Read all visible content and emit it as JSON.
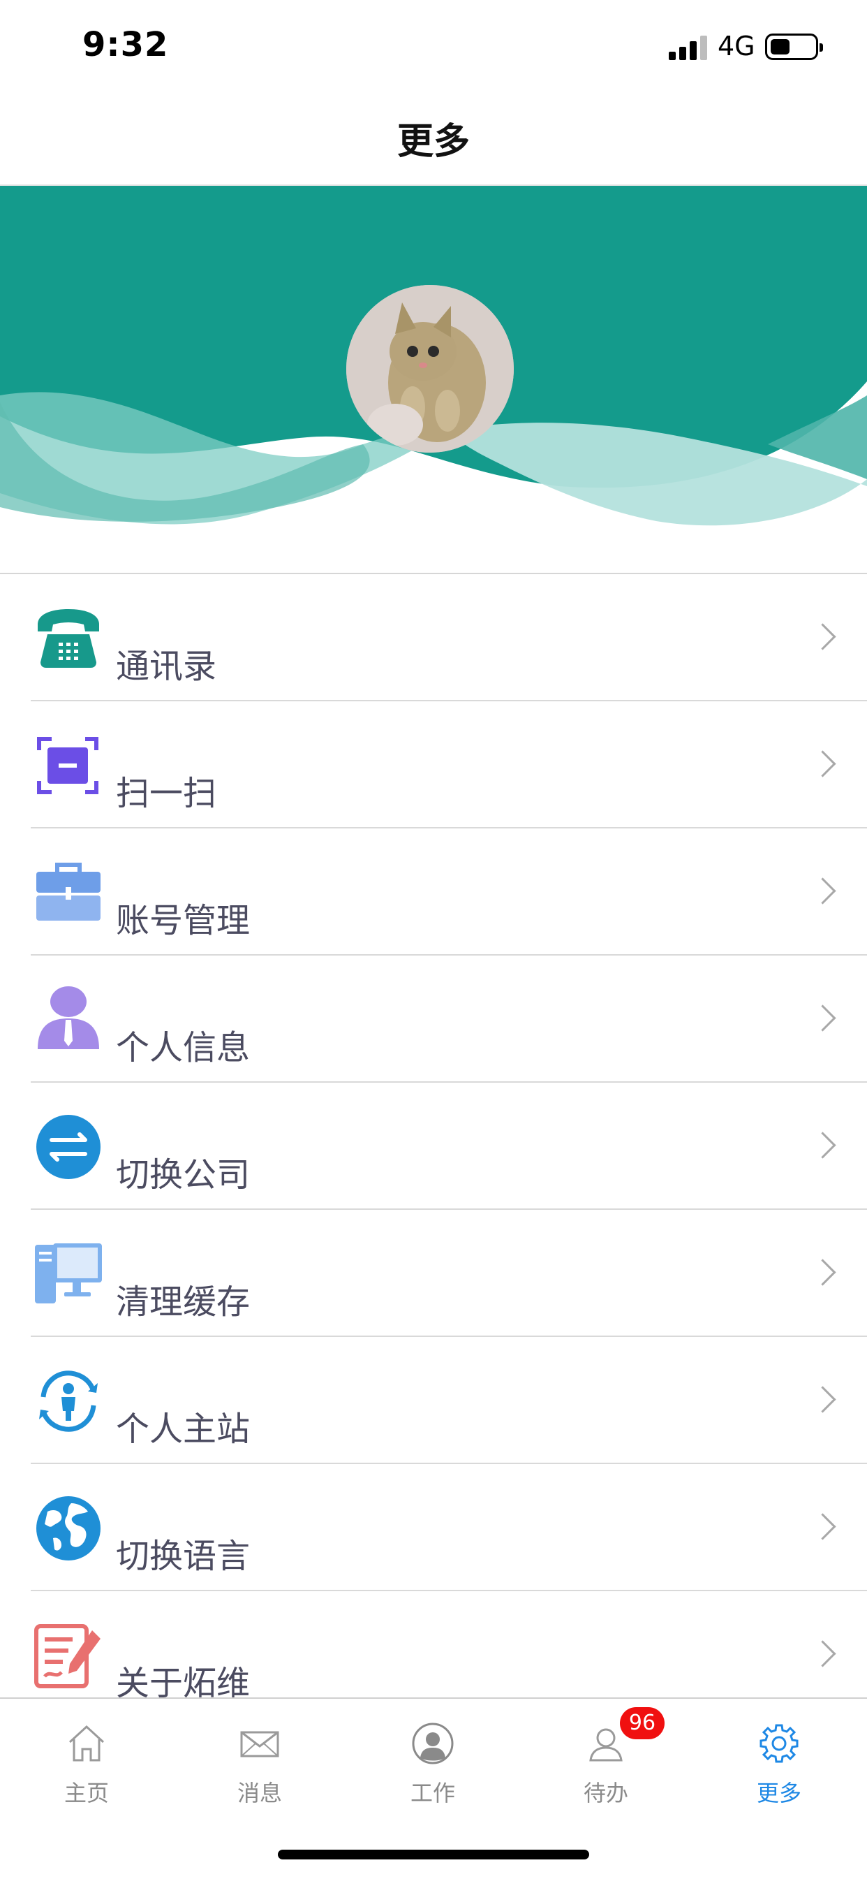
{
  "status": {
    "time": "9:32",
    "network": "4G",
    "battery_level": 0.45
  },
  "nav": {
    "title": "更多"
  },
  "header": {
    "colors": {
      "primary": "#149b8c",
      "wave_light": "#7fcdc4",
      "wave_pale": "#b4e2dd"
    }
  },
  "menu": {
    "items": [
      {
        "label": "通讯录",
        "icon": "phone-icon"
      },
      {
        "label": "扫一扫",
        "icon": "scan-icon"
      },
      {
        "label": "账号管理",
        "icon": "briefcase-icon"
      },
      {
        "label": "个人信息",
        "icon": "person-tie-icon"
      },
      {
        "label": "切换公司",
        "icon": "switch-arrows-icon"
      },
      {
        "label": "清理缓存",
        "icon": "computer-icon"
      },
      {
        "label": "个人主站",
        "icon": "person-refresh-icon"
      },
      {
        "label": "切换语言",
        "icon": "globe-icon"
      },
      {
        "label": "关于炻维",
        "icon": "document-edit-icon"
      }
    ]
  },
  "tabbar": {
    "tabs": [
      {
        "label": "主页",
        "icon": "home-icon",
        "active": false
      },
      {
        "label": "消息",
        "icon": "mail-icon",
        "active": false
      },
      {
        "label": "工作",
        "icon": "user-circle-icon",
        "active": false
      },
      {
        "label": "待办",
        "icon": "user-outline-icon",
        "active": false,
        "badge": "96"
      },
      {
        "label": "更多",
        "icon": "gear-icon",
        "active": true
      }
    ],
    "active_color": "#1e88e5",
    "badge_color": "#f01010"
  }
}
